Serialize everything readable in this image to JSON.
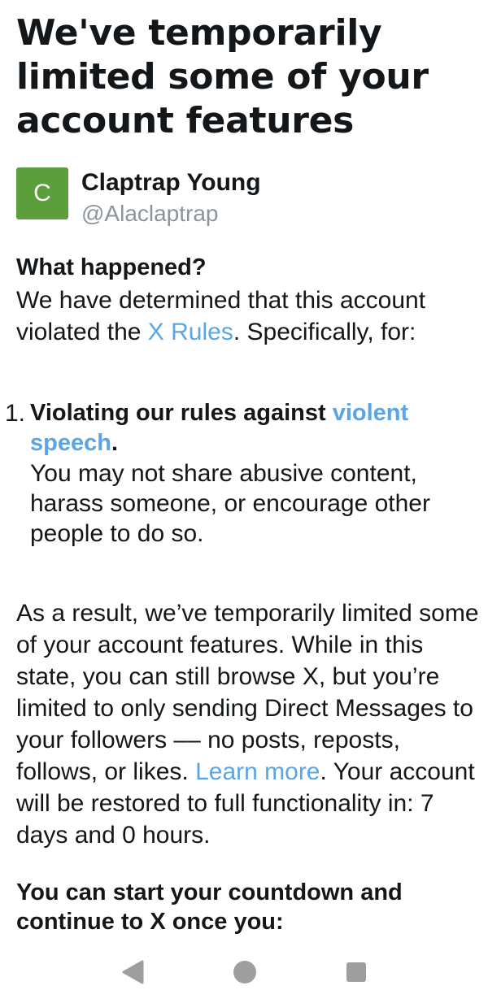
{
  "title": "We've temporarily limited some of your account features",
  "profile": {
    "avatar_letter": "C",
    "avatar_color": "#5c9e3c",
    "name": "Claptrap Young",
    "handle": "@Alaclaptrap"
  },
  "what_happened": {
    "heading": "What happened?",
    "text_before_link": "We have determined that this account violated the ",
    "link": "X Rules",
    "text_after_link": ". Specifically, for:"
  },
  "violations": [
    {
      "number": "1.",
      "title_prefix": "Violating our rules against ",
      "title_link": "violent speech",
      "title_suffix": ".",
      "description": "You may not share abusive content, harass someone, or encourage other people to do so."
    }
  ],
  "result": {
    "text_before_link": "As a result, we’ve temporarily limited some of your account features. While in this state, you can still browse X, but you’re limited to only sending Direct Messages to your followers –– no posts, reposts, follows, or likes. ",
    "link": "Learn more",
    "text_after_link": ". Your account will be restored to full functionality in: 7 days and 0 hours."
  },
  "countdown_heading": "You can start your countdown and continue to X once you:",
  "nav_icons": [
    "back-triangle-icon",
    "home-circle-icon",
    "recents-square-icon"
  ],
  "colors": {
    "link": "#5aa5e6",
    "text": "#14171a",
    "muted": "#8a949c",
    "nav_icon": "#9e9e9e"
  }
}
